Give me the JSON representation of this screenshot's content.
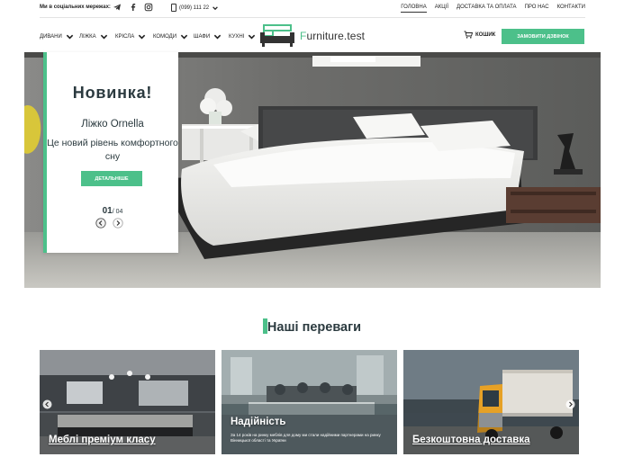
{
  "topbar": {
    "social_label": "Ми в соціальних мережах:",
    "social_icons": [
      "telegram-icon",
      "facebook-icon",
      "instagram-icon"
    ],
    "phone": "(099) 111 22",
    "nav": [
      "ГОЛОВНА",
      "АКЦІЇ",
      "ДОСТАВКА ТА ОПЛАТА",
      "ПРО НАС",
      "КОНТАКТИ"
    ],
    "active_index": 0
  },
  "mainnav": {
    "items": [
      "ДИВАНИ",
      "ЛІЖКА",
      "КРІСЛА",
      "КОМОДИ",
      "ШАФИ",
      "КУХНІ"
    ],
    "logo_first": "F",
    "logo_rest": "urniture.test",
    "cart_label": "КОШИК",
    "callback_label": "ЗАМОВИТИ ДЗВІНОК"
  },
  "hero": {
    "title": "Новинка!",
    "subtitle": "Ліжко Ornella",
    "description": "Це новий рівень комфортного сну",
    "button": "ДЕТАЛЬНІШЕ",
    "current": "01",
    "total": "/ 04"
  },
  "advantages": {
    "title": "Наші переваги",
    "cards": [
      {
        "title": "Меблі преміум класу",
        "description": ""
      },
      {
        "title": "Надійність",
        "description": "За 14 років на ринку меблів для дому ми стали надійними партнерами на ринку Вінницької області та України"
      },
      {
        "title": "Безкоштовна доставка",
        "description": ""
      }
    ]
  },
  "colors": {
    "accent": "#4cc08a",
    "text": "#2b3a3f"
  }
}
